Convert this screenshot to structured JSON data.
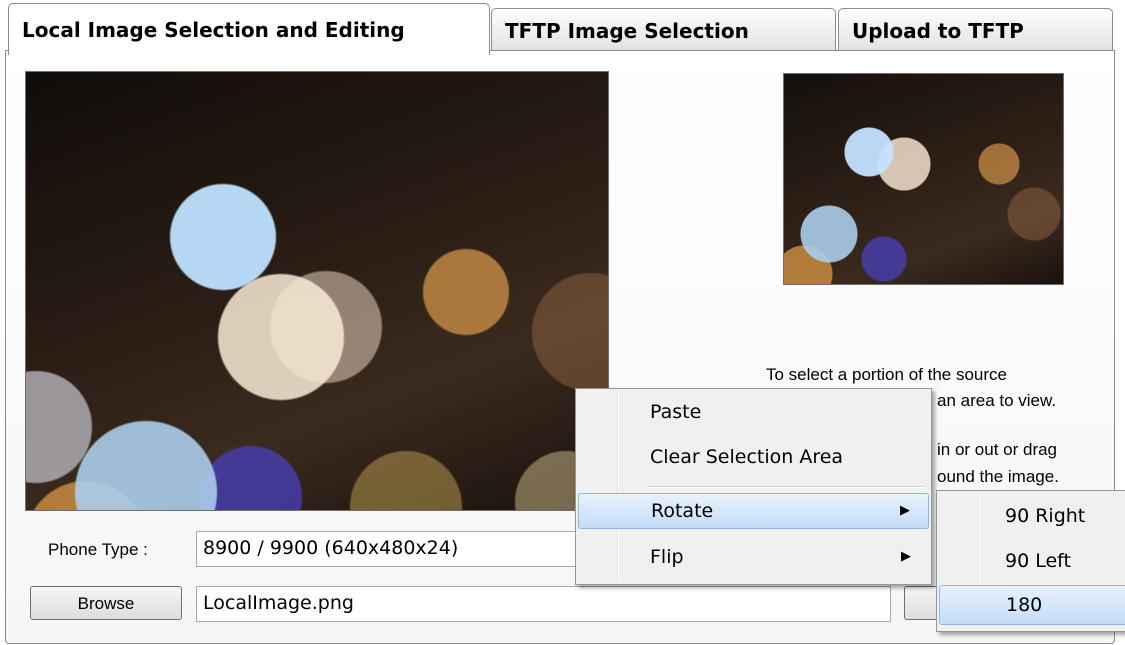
{
  "tabs": [
    {
      "label": "Local Image Selection and Editing",
      "active": true
    },
    {
      "label": "TFTP Image Selection",
      "active": false
    },
    {
      "label": "Upload to TFTP",
      "active": false
    }
  ],
  "hint": {
    "line1": "To select a portion of the source",
    "line2": "an area to view.",
    "line3": "in or out or drag",
    "line4": "ound the image."
  },
  "phone_type": {
    "label": "Phone Type :",
    "value": "8900 / 9900 (640x480x24)"
  },
  "browse": {
    "button_label": "Browse",
    "file_value": "LocalImage.png"
  },
  "context_menu": {
    "items": [
      {
        "label": "Paste",
        "has_submenu": false
      },
      {
        "label": "Clear Selection Area",
        "has_submenu": false
      },
      {
        "label": "Rotate",
        "has_submenu": true,
        "highlighted": true
      },
      {
        "label": "Flip",
        "has_submenu": true
      }
    ],
    "submenu_arrow": "▶"
  },
  "rotate_submenu": {
    "items": [
      {
        "label": "90 Right"
      },
      {
        "label": "90 Left"
      },
      {
        "label": "180",
        "highlighted": true
      }
    ]
  },
  "colors": {
    "highlight": "#c4ddf8",
    "menu_bg": "#f0f0f0"
  }
}
